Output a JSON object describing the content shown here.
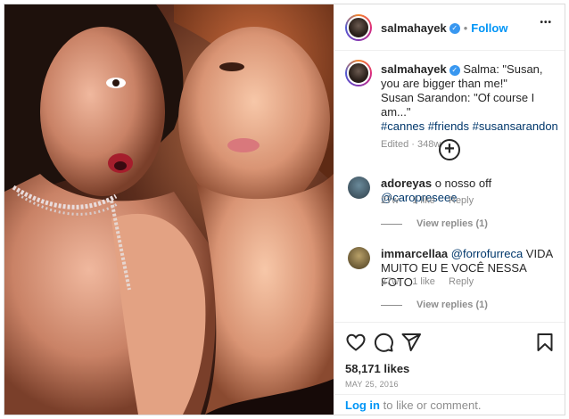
{
  "post": {
    "username": "salmahayek",
    "follow_label": "Follow",
    "separator": "•",
    "more_label": "•••",
    "caption_prefix": "Salma: \"Susan, you are bigger than me!\"",
    "caption_line2": "Susan Sarandon: \"Of course I am...\"",
    "hashtags": [
      "#cannes",
      "#friends",
      "#susansarandon"
    ],
    "edited_meta": "Edited · 348w",
    "load_more_icon": "plus-circle-icon"
  },
  "comments": [
    {
      "username": "adoreyas",
      "text": "o nosso off ",
      "mention": "@caropreseee",
      "age": "27w",
      "likes": "1 like",
      "reply_label": "Reply",
      "view_replies": "View replies (1)"
    },
    {
      "username": "immarcellaa",
      "mention": "@forrofurreca",
      "text": " VIDA MUITO EU E VOCÊ NESSA FOTO",
      "age": "27w",
      "likes": "1 like",
      "reply_label": "Reply",
      "view_replies": "View replies (1)"
    }
  ],
  "actions": {
    "like_icon": "heart-icon",
    "comment_icon": "comment-bubble-icon",
    "share_icon": "paper-plane-icon",
    "save_icon": "bookmark-icon",
    "likes_count": "58,171 likes",
    "date": "MAY 25, 2016"
  },
  "login": {
    "link_label": "Log in",
    "rest_text": " to like or comment."
  },
  "colors": {
    "accent": "#0095f6",
    "verified": "#3897f0",
    "hashtag": "#00376b",
    "muted": "#8e8e8e"
  }
}
